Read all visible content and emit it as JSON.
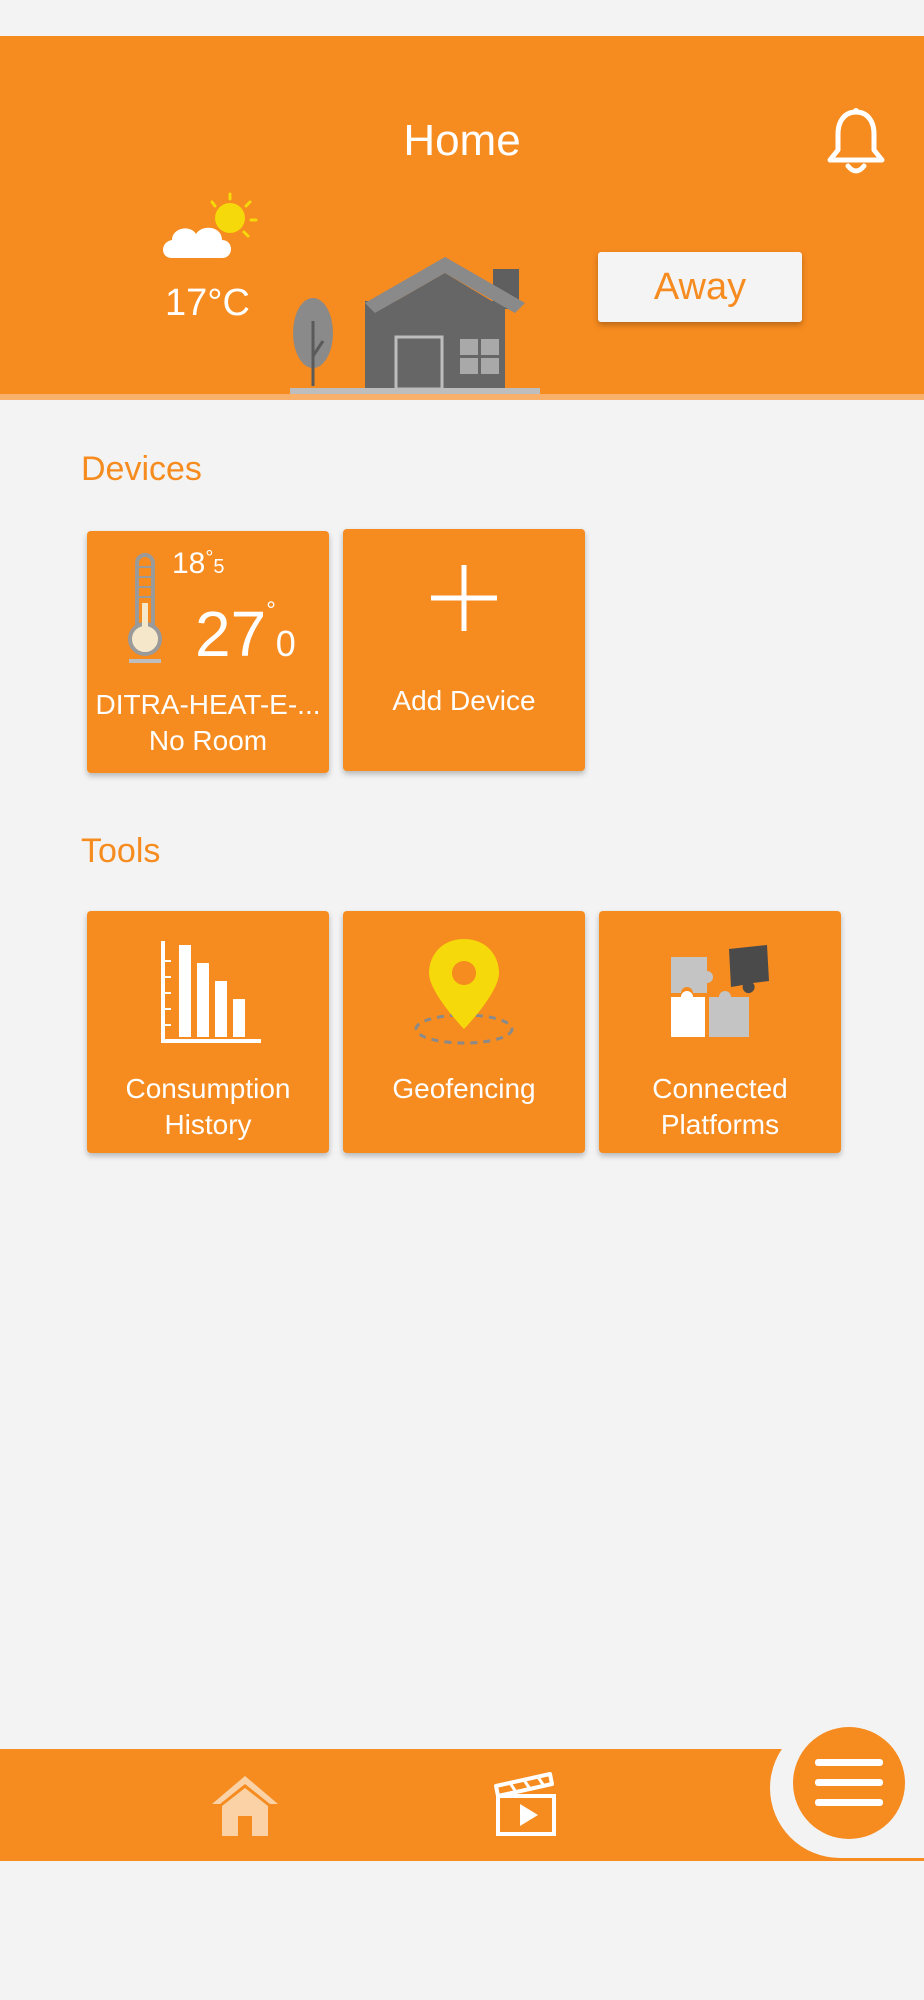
{
  "header": {
    "title": "Home",
    "temperature": "17°C",
    "away_label": "Away"
  },
  "devices": {
    "section_title": "Devices",
    "device": {
      "current_temp_int": "18",
      "current_temp_dec": "5",
      "set_temp_int": "27",
      "set_temp_dec": "0",
      "name": "DITRA-HEAT-E-...",
      "room": "No Room"
    },
    "add_device_label": "Add Device"
  },
  "tools": {
    "section_title": "Tools",
    "items": [
      {
        "label_line1": "Consumption",
        "label_line2": "History",
        "icon": "bar-chart-icon"
      },
      {
        "label_line1": "Geofencing",
        "label_line2": "",
        "icon": "location-pin-icon"
      },
      {
        "label_line1": "Connected",
        "label_line2": "Platforms",
        "icon": "puzzle-icon"
      }
    ]
  },
  "bottom_nav": {
    "items": [
      {
        "icon": "home-icon"
      },
      {
        "icon": "video-clapper-icon"
      },
      {
        "icon": "menu-icon"
      }
    ]
  },
  "colors": {
    "accent": "#f68b1f",
    "background": "#f3f3f3",
    "house_gray": "#666666",
    "pin_yellow": "#f5d90a"
  }
}
